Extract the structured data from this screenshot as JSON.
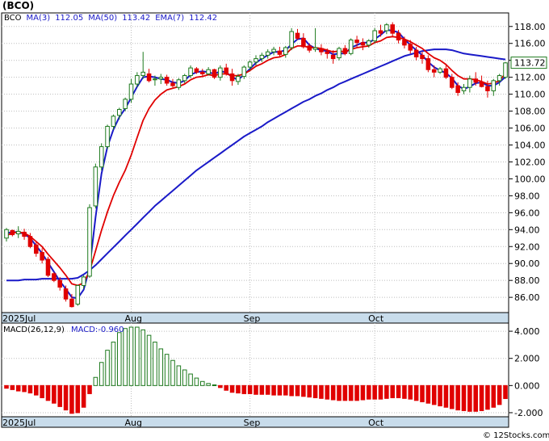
{
  "chart_data": [
    {
      "type": "candlestick",
      "title": "(BCO)",
      "legend": [
        {
          "text": "BCO",
          "color": "#000000"
        },
        {
          "text": "MA(3)",
          "color": "#1a1ac8"
        },
        {
          "text": "112.05",
          "color": "#1a1ac8"
        },
        {
          "text": "MA(50)",
          "color": "#1a1ac8"
        },
        {
          "text": "113.42",
          "color": "#1a1ac8"
        },
        {
          "text": "EMA(7)",
          "color": "#1a1ac8"
        },
        {
          "text": "112.42",
          "color": "#1a1ac8"
        }
      ],
      "ylim": [
        84.2,
        119.6
      ],
      "yticks": [
        "86.00",
        "88.00",
        "90.00",
        "92.00",
        "94.00",
        "96.00",
        "98.00",
        "100.00",
        "102.00",
        "104.00",
        "106.00",
        "108.00",
        "110.00",
        "112.00",
        "114.00",
        "116.00",
        "118.00"
      ],
      "x_labels": [
        {
          "text": "2025Jul",
          "index": 0
        },
        {
          "text": "Aug",
          "index": 21
        },
        {
          "text": "Sep",
          "index": 41
        },
        {
          "text": "Oct",
          "index": 62
        }
      ],
      "last_price": "113.72",
      "colors": {
        "up_fill": "#ffffff",
        "up_outline": "#1e7a1e",
        "down": "#e00000",
        "ma_fast": "#1a1ac8",
        "ma_slow": "#1a1ac8",
        "ema": "#e00000"
      },
      "candles": [
        [
          93.0,
          94.2,
          92.6,
          94.0
        ],
        [
          93.9,
          94.0,
          93.2,
          93.4
        ],
        [
          93.5,
          94.4,
          93.0,
          93.8
        ],
        [
          93.7,
          94.1,
          92.8,
          93.2
        ],
        [
          93.2,
          93.6,
          91.8,
          92.0
        ],
        [
          92.2,
          92.6,
          90.8,
          91.2
        ],
        [
          91.3,
          91.8,
          90.0,
          90.4
        ],
        [
          90.5,
          90.8,
          88.4,
          88.6
        ],
        [
          88.8,
          89.0,
          87.8,
          88.0
        ],
        [
          88.0,
          88.4,
          86.8,
          87.2
        ],
        [
          87.0,
          87.4,
          85.5,
          85.8
        ],
        [
          85.8,
          86.4,
          84.8,
          84.9
        ],
        [
          85.2,
          87.5,
          85.0,
          87.4
        ],
        [
          87.4,
          88.6,
          87.0,
          88.4
        ],
        [
          88.5,
          97.0,
          88.3,
          96.6
        ],
        [
          96.8,
          101.8,
          96.5,
          101.4
        ],
        [
          101.4,
          104.2,
          101.0,
          103.8
        ],
        [
          103.8,
          106.4,
          103.5,
          106.2
        ],
        [
          106.2,
          107.6,
          105.8,
          107.4
        ],
        [
          107.5,
          108.4,
          107.0,
          108.2
        ],
        [
          108.3,
          109.6,
          108.0,
          109.4
        ],
        [
          109.4,
          111.8,
          109.0,
          111.2
        ],
        [
          111.2,
          112.6,
          110.8,
          112.2
        ],
        [
          112.2,
          115.0,
          111.8,
          112.6
        ],
        [
          112.4,
          113.0,
          111.4,
          111.6
        ],
        [
          111.7,
          112.2,
          111.0,
          111.8
        ],
        [
          111.8,
          112.4,
          111.2,
          112.0
        ],
        [
          112.0,
          112.3,
          111.0,
          111.3
        ],
        [
          111.3,
          111.8,
          110.8,
          111.0
        ],
        [
          110.8,
          111.9,
          110.5,
          111.7
        ],
        [
          111.6,
          112.4,
          111.3,
          112.2
        ],
        [
          112.2,
          113.4,
          111.9,
          113.1
        ],
        [
          113.0,
          113.2,
          112.4,
          112.6
        ],
        [
          112.6,
          113.0,
          112.0,
          112.4
        ],
        [
          112.4,
          113.2,
          112.2,
          112.9
        ],
        [
          112.9,
          113.0,
          111.8,
          112.0
        ],
        [
          112.0,
          113.4,
          111.6,
          113.1
        ],
        [
          113.1,
          113.6,
          112.2,
          112.4
        ],
        [
          112.4,
          113.0,
          111.0,
          111.6
        ],
        [
          111.5,
          112.4,
          111.1,
          112.1
        ],
        [
          112.1,
          113.4,
          111.8,
          113.2
        ],
        [
          113.2,
          114.0,
          112.8,
          113.8
        ],
        [
          113.8,
          114.6,
          113.4,
          114.2
        ],
        [
          114.2,
          114.9,
          113.8,
          114.6
        ],
        [
          114.6,
          115.3,
          114.2,
          115.0
        ],
        [
          115.0,
          115.6,
          114.6,
          115.3
        ],
        [
          115.1,
          115.6,
          114.4,
          114.7
        ],
        [
          114.7,
          115.7,
          114.3,
          115.5
        ],
        [
          115.5,
          117.8,
          115.2,
          117.4
        ],
        [
          117.2,
          117.7,
          116.4,
          116.6
        ],
        [
          116.6,
          117.2,
          115.4,
          115.6
        ],
        [
          115.7,
          116.0,
          114.9,
          115.2
        ],
        [
          115.3,
          117.8,
          115.0,
          115.5
        ],
        [
          115.4,
          115.9,
          114.6,
          115.0
        ],
        [
          115.0,
          115.4,
          114.2,
          114.8
        ],
        [
          114.6,
          115.2,
          113.6,
          114.2
        ],
        [
          114.3,
          115.6,
          114.0,
          115.4
        ],
        [
          115.4,
          115.8,
          114.6,
          114.8
        ],
        [
          114.8,
          116.6,
          114.6,
          116.4
        ],
        [
          116.4,
          116.9,
          115.6,
          116.1
        ],
        [
          116.1,
          116.6,
          115.2,
          115.8
        ],
        [
          115.8,
          116.5,
          115.5,
          116.3
        ],
        [
          116.3,
          117.8,
          116.0,
          117.5
        ],
        [
          117.5,
          118.2,
          116.8,
          117.2
        ],
        [
          117.5,
          118.4,
          117.1,
          118.2
        ],
        [
          118.2,
          118.5,
          116.8,
          117.2
        ],
        [
          117.2,
          117.6,
          116.0,
          116.4
        ],
        [
          116.4,
          116.8,
          115.4,
          115.8
        ],
        [
          115.9,
          116.4,
          114.8,
          115.2
        ],
        [
          115.2,
          115.6,
          114.0,
          114.4
        ],
        [
          114.6,
          115.0,
          113.6,
          114.2
        ],
        [
          114.2,
          114.6,
          112.6,
          112.9
        ],
        [
          112.9,
          113.4,
          112.0,
          112.6
        ],
        [
          112.6,
          113.2,
          112.4,
          113.0
        ],
        [
          113.0,
          113.6,
          111.8,
          112.0
        ],
        [
          112.0,
          112.4,
          110.6,
          110.8
        ],
        [
          111.0,
          111.4,
          109.8,
          110.2
        ],
        [
          110.4,
          111.2,
          110.0,
          110.8
        ],
        [
          110.8,
          112.2,
          110.2,
          111.8
        ],
        [
          111.8,
          112.6,
          111.0,
          111.4
        ],
        [
          111.4,
          112.2,
          110.8,
          110.9
        ],
        [
          110.9,
          111.6,
          109.6,
          110.4
        ],
        [
          110.4,
          111.8,
          109.8,
          111.6
        ],
        [
          111.6,
          112.4,
          111.0,
          112.2
        ],
        [
          112.0,
          113.8,
          111.8,
          113.7
        ]
      ],
      "ma_fast": [
        93.6,
        93.7,
        93.7,
        93.5,
        93.0,
        92.1,
        91.2,
        90.1,
        89.0,
        87.9,
        87.0,
        86.0,
        85.9,
        86.9,
        89.5,
        95.5,
        100.6,
        103.8,
        105.8,
        107.3,
        108.3,
        109.6,
        110.9,
        112.0,
        112.1,
        112.0,
        111.8,
        111.7,
        111.4,
        111.3,
        111.6,
        112.3,
        112.6,
        112.7,
        112.6,
        112.4,
        112.7,
        112.6,
        112.0,
        111.7,
        112.3,
        113.0,
        113.7,
        114.2,
        114.6,
        115.0,
        115.0,
        115.2,
        115.9,
        116.5,
        116.6,
        115.8,
        115.4,
        115.2,
        115.1,
        114.7,
        114.8,
        114.8,
        115.5,
        115.8,
        116.1,
        116.1,
        116.5,
        117.0,
        117.6,
        117.5,
        117.3,
        116.5,
        115.8,
        115.2,
        114.6,
        113.8,
        113.2,
        112.8,
        112.5,
        111.9,
        111.0,
        110.6,
        110.9,
        111.3,
        111.4,
        111.0,
        111.0,
        111.4,
        112.05
      ],
      "ma_slow": [
        88.0,
        88.0,
        88.0,
        88.1,
        88.1,
        88.1,
        88.2,
        88.2,
        88.2,
        88.2,
        88.2,
        88.2,
        88.3,
        88.7,
        89.2,
        89.8,
        90.5,
        91.2,
        91.9,
        92.6,
        93.3,
        94.0,
        94.7,
        95.4,
        96.1,
        96.8,
        97.4,
        98.0,
        98.6,
        99.2,
        99.8,
        100.4,
        101.0,
        101.5,
        102.0,
        102.5,
        103.0,
        103.5,
        104.0,
        104.5,
        105.0,
        105.4,
        105.8,
        106.2,
        106.7,
        107.1,
        107.5,
        107.9,
        108.3,
        108.7,
        109.1,
        109.4,
        109.8,
        110.1,
        110.5,
        110.8,
        111.2,
        111.5,
        111.8,
        112.1,
        112.4,
        112.7,
        113.0,
        113.3,
        113.6,
        113.9,
        114.2,
        114.5,
        114.7,
        114.9,
        115.1,
        115.2,
        115.3,
        115.3,
        115.3,
        115.2,
        115.0,
        114.8,
        114.7,
        114.6,
        114.5,
        114.4,
        114.3,
        114.2,
        114.1
      ],
      "ema": [
        93.3,
        93.6,
        93.7,
        93.6,
        93.2,
        92.6,
        92.0,
        91.1,
        90.3,
        89.5,
        88.6,
        87.6,
        87.4,
        87.7,
        89.1,
        91.5,
        93.9,
        96.1,
        98.0,
        99.6,
        101.0,
        102.8,
        104.9,
        106.9,
        108.3,
        109.3,
        110.0,
        110.5,
        110.7,
        110.9,
        111.2,
        111.7,
        112.0,
        112.1,
        112.3,
        112.2,
        112.4,
        112.4,
        112.2,
        112.2,
        112.4,
        112.8,
        113.3,
        113.6,
        114.0,
        114.3,
        114.4,
        114.7,
        115.4,
        115.7,
        115.7,
        115.5,
        115.5,
        115.4,
        115.2,
        115.0,
        115.1,
        115.0,
        115.3,
        115.5,
        115.6,
        115.7,
        116.1,
        116.3,
        116.7,
        116.8,
        116.7,
        116.5,
        116.2,
        115.8,
        115.4,
        114.8,
        114.3,
        114.0,
        113.5,
        112.8,
        112.2,
        111.8,
        111.8,
        111.7,
        111.5,
        111.2,
        111.3,
        111.6,
        112.42
      ]
    },
    {
      "type": "bar",
      "title": "MACD(26,12,9)",
      "subtitle": "MACD:-0.960",
      "ylim": [
        -2.3,
        4.6
      ],
      "yticks": [
        "4.000",
        "2.000",
        "0.000",
        "-2.000"
      ],
      "colors": {
        "positive": "#1e7a1e",
        "negative": "#e00000"
      },
      "values": [
        -0.2,
        -0.3,
        -0.4,
        -0.45,
        -0.55,
        -0.7,
        -0.9,
        -1.1,
        -1.3,
        -1.55,
        -1.8,
        -2.05,
        -2.0,
        -1.6,
        -0.6,
        0.6,
        1.7,
        2.6,
        3.2,
        3.9,
        4.2,
        4.3,
        4.3,
        4.1,
        3.7,
        3.2,
        2.7,
        2.3,
        1.85,
        1.45,
        1.15,
        0.85,
        0.55,
        0.3,
        0.15,
        0.05,
        -0.15,
        -0.35,
        -0.5,
        -0.55,
        -0.6,
        -0.6,
        -0.65,
        -0.65,
        -0.65,
        -0.7,
        -0.7,
        -0.7,
        -0.75,
        -0.75,
        -0.8,
        -0.85,
        -0.9,
        -0.95,
        -1.0,
        -1.05,
        -1.1,
        -1.1,
        -1.1,
        -1.1,
        -1.05,
        -1.0,
        -1.0,
        -1.0,
        -0.95,
        -0.9,
        -0.9,
        -0.95,
        -1.0,
        -1.1,
        -1.2,
        -1.3,
        -1.4,
        -1.5,
        -1.6,
        -1.7,
        -1.8,
        -1.85,
        -1.9,
        -1.9,
        -1.85,
        -1.75,
        -1.6,
        -1.4,
        -0.96
      ]
    }
  ],
  "watermark": "© 12Stocks.com"
}
